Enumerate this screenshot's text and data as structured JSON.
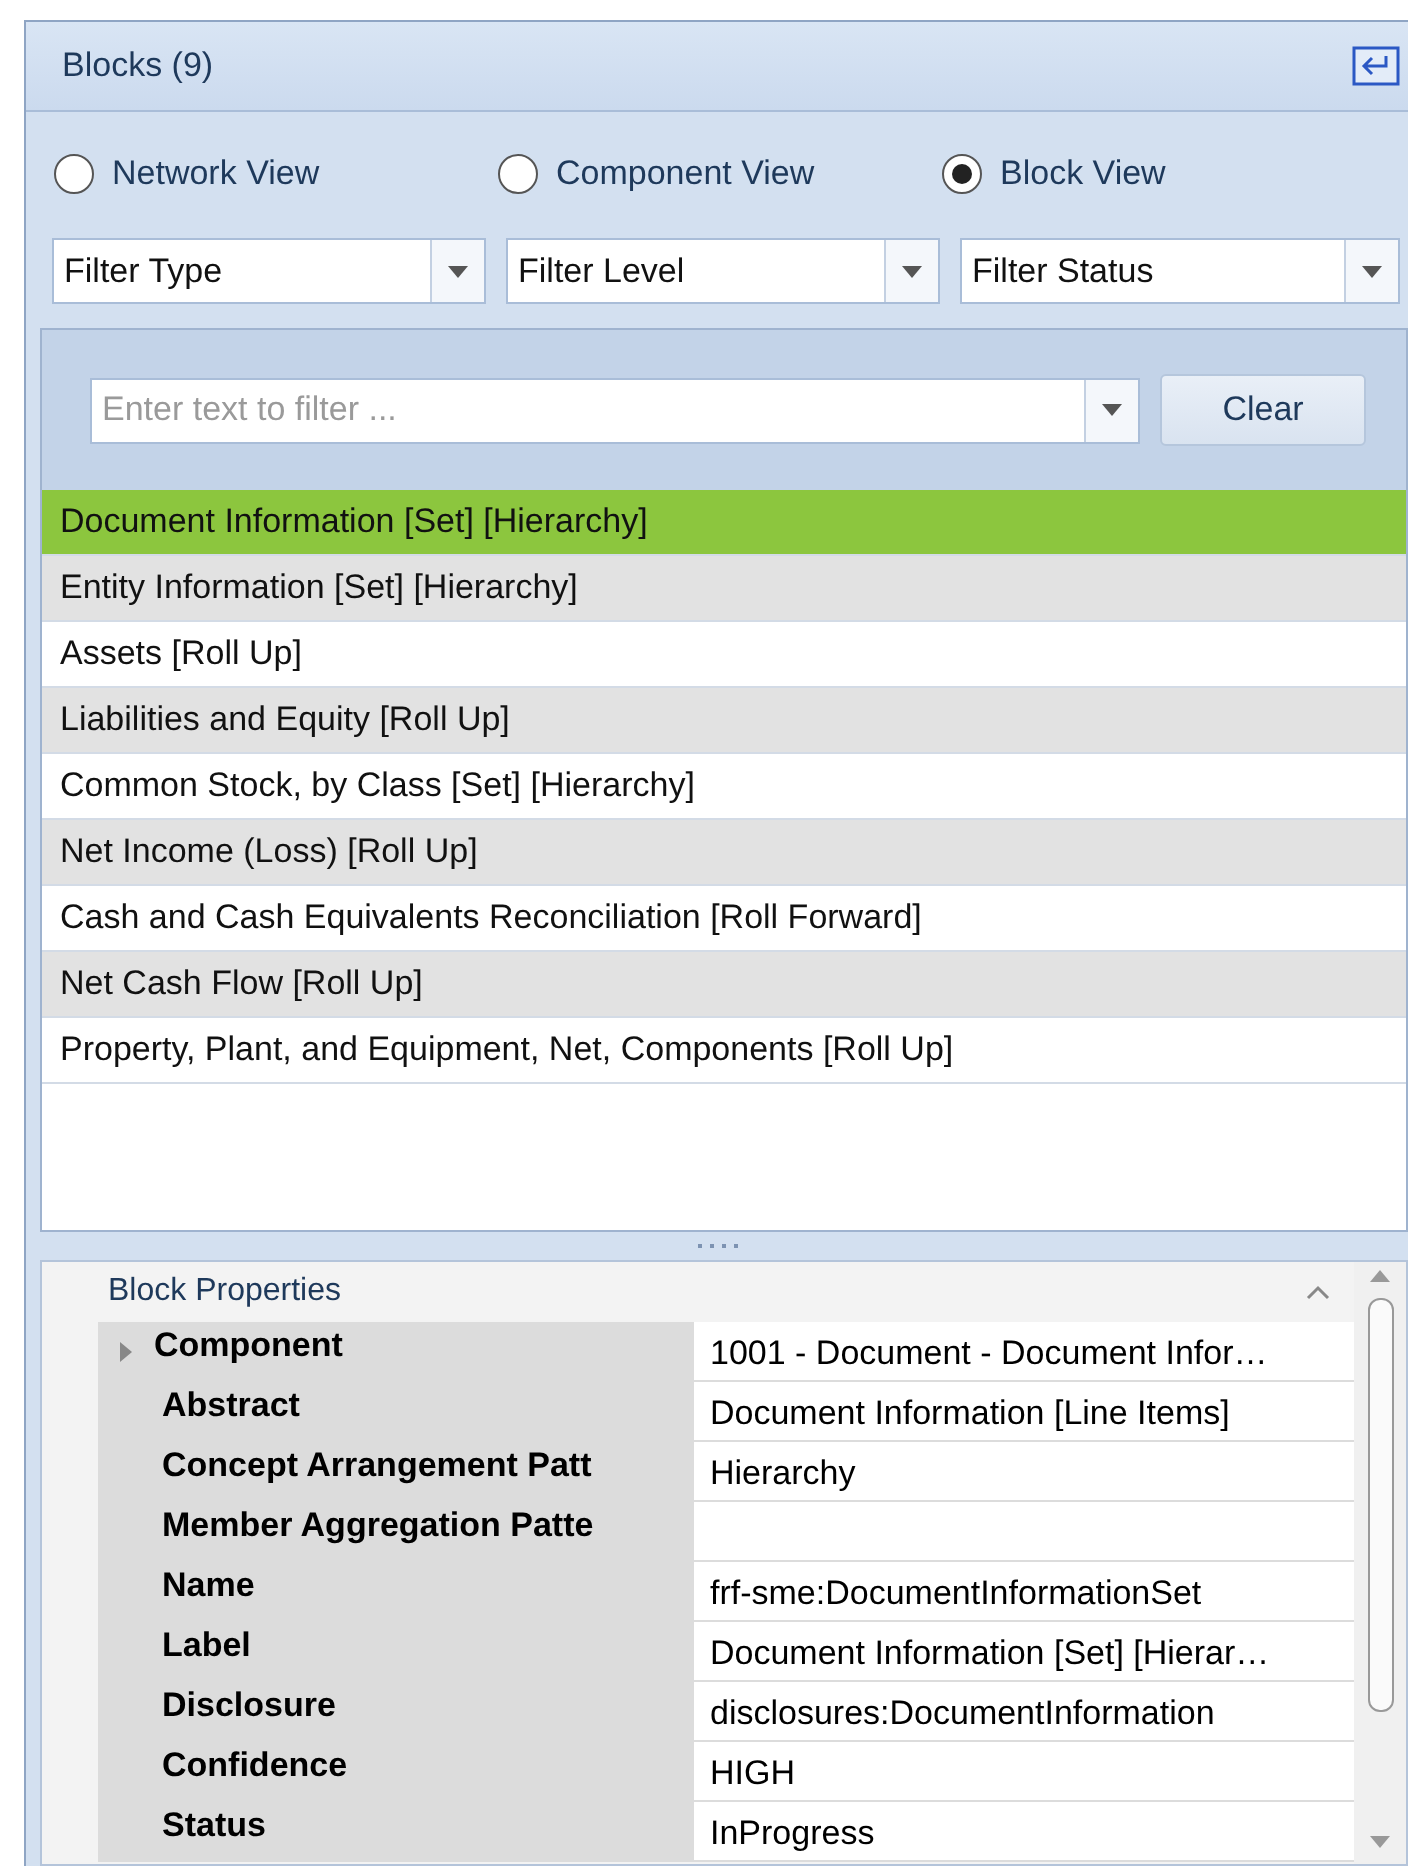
{
  "panel": {
    "title": "Blocks (9)"
  },
  "views": [
    {
      "label": "Network View",
      "selected": false
    },
    {
      "label": "Component View",
      "selected": false
    },
    {
      "label": "Block View",
      "selected": true
    }
  ],
  "filters": [
    {
      "value": "Filter Type"
    },
    {
      "value": "Filter Level"
    },
    {
      "value": "Filter Status"
    }
  ],
  "search": {
    "placeholder": "Enter text to filter ...",
    "button": "Clear"
  },
  "blocks": [
    {
      "label": "Document Information [Set] [Hierarchy]",
      "selected": true
    },
    {
      "label": "Entity Information [Set] [Hierarchy]",
      "selected": false
    },
    {
      "label": "Assets [Roll Up]",
      "selected": false
    },
    {
      "label": "Liabilities and Equity [Roll Up]",
      "selected": false
    },
    {
      "label": "Common Stock, by Class [Set] [Hierarchy]",
      "selected": false
    },
    {
      "label": "Net Income (Loss) [Roll Up]",
      "selected": false
    },
    {
      "label": "Cash and Cash Equivalents Reconciliation [Roll Forward]",
      "selected": false
    },
    {
      "label": "Net Cash Flow [Roll Up]",
      "selected": false
    },
    {
      "label": "Property, Plant, and Equipment, Net, Components [Roll Up]",
      "selected": false
    }
  ],
  "properties": {
    "title": "Block Properties",
    "rows": [
      {
        "name": "Component",
        "value": "1001 - Document - Document Infor…",
        "expanded": false
      },
      {
        "name": "Abstract",
        "value": "Document Information [Line Items]"
      },
      {
        "name": "Concept Arrangement Patt",
        "value": "Hierarchy"
      },
      {
        "name": "Member Aggregation Patte"
      },
      {
        "name": "Name",
        "value": "frf-sme:DocumentInformationSet"
      },
      {
        "name": "Label",
        "value": "Document Information [Set] [Hierar…"
      },
      {
        "name": "Disclosure",
        "value": "disclosures:DocumentInformation"
      },
      {
        "name": "Confidence",
        "value": "HIGH"
      },
      {
        "name": "Status",
        "value": "InProgress"
      }
    ]
  }
}
